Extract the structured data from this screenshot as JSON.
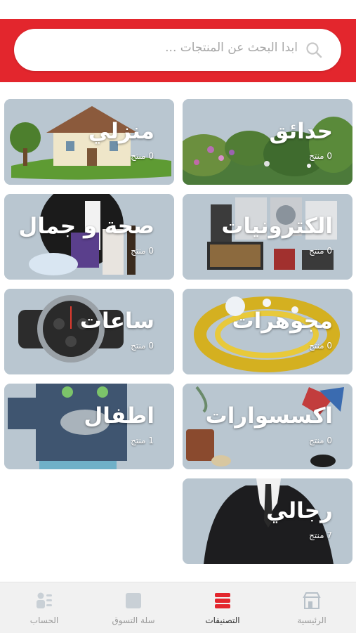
{
  "search": {
    "placeholder": "ابدا البحث عن المنتجات ..."
  },
  "categories": [
    {
      "title": "حدائق",
      "count": "0 منتج"
    },
    {
      "title": "منزلي",
      "count": "0 منتج"
    },
    {
      "title": "الكترونيات",
      "count": "0 منتج"
    },
    {
      "title": "صحة و جمال",
      "count": "0 منتج"
    },
    {
      "title": "مجوهرات",
      "count": "0 منتج"
    },
    {
      "title": "ساعات",
      "count": "0 منتج"
    },
    {
      "title": "اكسسوارات",
      "count": "0 منتج"
    },
    {
      "title": "اطفال",
      "count": "1 منتج"
    },
    {
      "title": "رجالي",
      "count": "7 منتج"
    }
  ],
  "nav": {
    "home": "الرئيسية",
    "categories": "التصنيفات",
    "cart": "سلة التسوق",
    "account": "الحساب",
    "active": "categories"
  },
  "colors": {
    "brand": "#e3262d",
    "active_icon": "#e3262d",
    "inactive_icon": "#c9d0d6"
  }
}
